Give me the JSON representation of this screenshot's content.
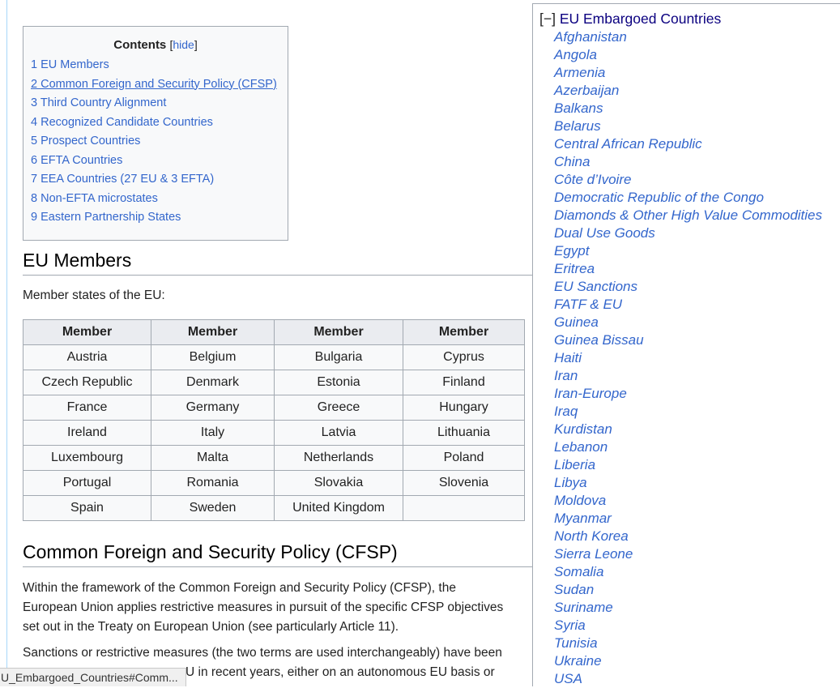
{
  "toc": {
    "title": "Contents",
    "hide_label": "hide",
    "items": [
      "1 EU Members",
      "2 Common Foreign and Security Policy (CFSP)",
      "3 Third Country Alignment",
      "4 Recognized Candidate Countries",
      "5 Prospect Countries",
      "6 EFTA Countries",
      "7 EEA Countries (27 EU & 3 EFTA)",
      "8 Non-EFTA microstates",
      "9 Eastern Partnership States"
    ]
  },
  "eu_section": {
    "heading": "EU Members",
    "intro": "Member states of the EU:",
    "table": {
      "headers": [
        "Member",
        "Member",
        "Member",
        "Member"
      ],
      "rows": [
        [
          "Austria",
          "Belgium",
          "Bulgaria",
          "Cyprus"
        ],
        [
          "Czech Republic",
          "Denmark",
          "Estonia",
          "Finland"
        ],
        [
          "France",
          "Germany",
          "Greece",
          "Hungary"
        ],
        [
          "Ireland",
          "Italy",
          "Latvia",
          "Lithuania"
        ],
        [
          "Luxembourg",
          "Malta",
          "Netherlands",
          "Poland"
        ],
        [
          "Portugal",
          "Romania",
          "Slovakia",
          "Slovenia"
        ],
        [
          "Spain",
          "Sweden",
          "United Kingdom",
          ""
        ]
      ]
    }
  },
  "cfsp_section": {
    "heading": "Common Foreign and Security Policy (CFSP)",
    "para1_lines": [
      "Within the framework of the Common Foreign and Security Policy (CFSP), the",
      "European Union applies restrictive measures in pursuit of the specific CFSP objectives",
      "set out in the Treaty on European Union (see particularly Article 11)."
    ],
    "para2_lines": [
      "Sanctions or restrictive measures (the two terms are used interchangeably) have been",
      "U in recent years, either on an autonomous EU basis or"
    ]
  },
  "navbox": {
    "toggle": "[−]",
    "title": "EU Embargoed Countries",
    "items": [
      "Afghanistan",
      "Angola",
      "Armenia",
      "Azerbaijan",
      "Balkans",
      "Belarus",
      "Central African Republic",
      "China",
      "Côte d’Ivoire",
      "Democratic Republic of the Congo",
      "Diamonds & Other High Value Commodities",
      "Dual Use Goods",
      "Egypt",
      "Eritrea",
      "EU Sanctions",
      "FATF & EU",
      "Guinea",
      "Guinea Bissau",
      "Haiti",
      "Iran",
      "Iran-Europe",
      "Iraq",
      "Kurdistan",
      "Lebanon",
      "Liberia",
      "Libya",
      "Moldova",
      "Myanmar",
      "North Korea",
      "Sierra Leone",
      "Somalia",
      "Sudan",
      "Suriname",
      "Syria",
      "Tunisia",
      "Ukraine",
      "USA"
    ]
  },
  "statusbar": {
    "url": "U_Embargoed_Countries#Comm..."
  }
}
